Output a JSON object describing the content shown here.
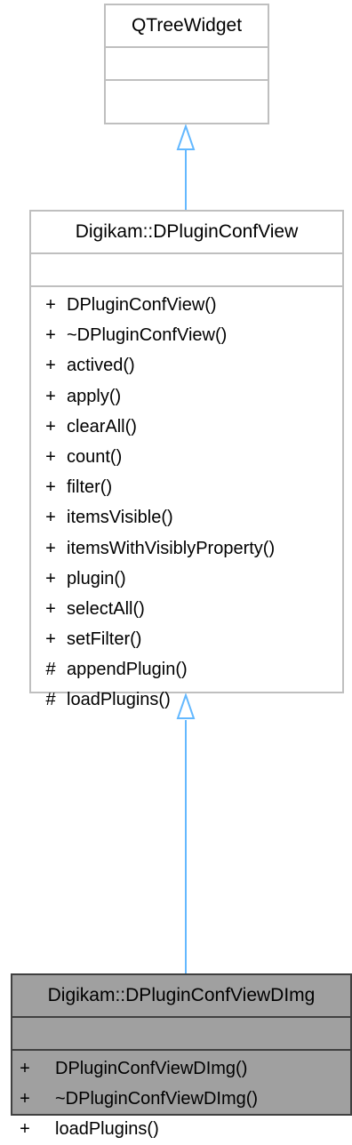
{
  "classes": {
    "qtreewidget": {
      "name": "QTreeWidget",
      "methods": []
    },
    "dpluginconfview": {
      "name": "Digikam::DPluginConfView",
      "methods": [
        {
          "visibility": "+",
          "name": "DPluginConfView()"
        },
        {
          "visibility": "+",
          "name": "~DPluginConfView()"
        },
        {
          "visibility": "+",
          "name": "actived()"
        },
        {
          "visibility": "+",
          "name": "apply()"
        },
        {
          "visibility": "+",
          "name": "clearAll()"
        },
        {
          "visibility": "+",
          "name": "count()"
        },
        {
          "visibility": "+",
          "name": "filter()"
        },
        {
          "visibility": "+",
          "name": "itemsVisible()"
        },
        {
          "visibility": "+",
          "name": "itemsWithVisiblyProperty()"
        },
        {
          "visibility": "+",
          "name": "plugin()"
        },
        {
          "visibility": "+",
          "name": "selectAll()"
        },
        {
          "visibility": "+",
          "name": "setFilter()"
        },
        {
          "visibility": "#",
          "name": "appendPlugin()"
        },
        {
          "visibility": "#",
          "name": "loadPlugins()"
        }
      ]
    },
    "dpluginconfviewdimg": {
      "name": "Digikam::DPluginConfViewDImg",
      "methods": [
        {
          "visibility": "+",
          "name": "DPluginConfViewDImg()"
        },
        {
          "visibility": "+",
          "name": "~DPluginConfViewDImg()"
        },
        {
          "visibility": "+",
          "name": "loadPlugins()"
        }
      ]
    }
  },
  "colors": {
    "box_border": "#bfbfbf",
    "highlight_fill": "#a0a0a0",
    "highlight_border": "#404040",
    "arrow": "#63b8ff"
  }
}
